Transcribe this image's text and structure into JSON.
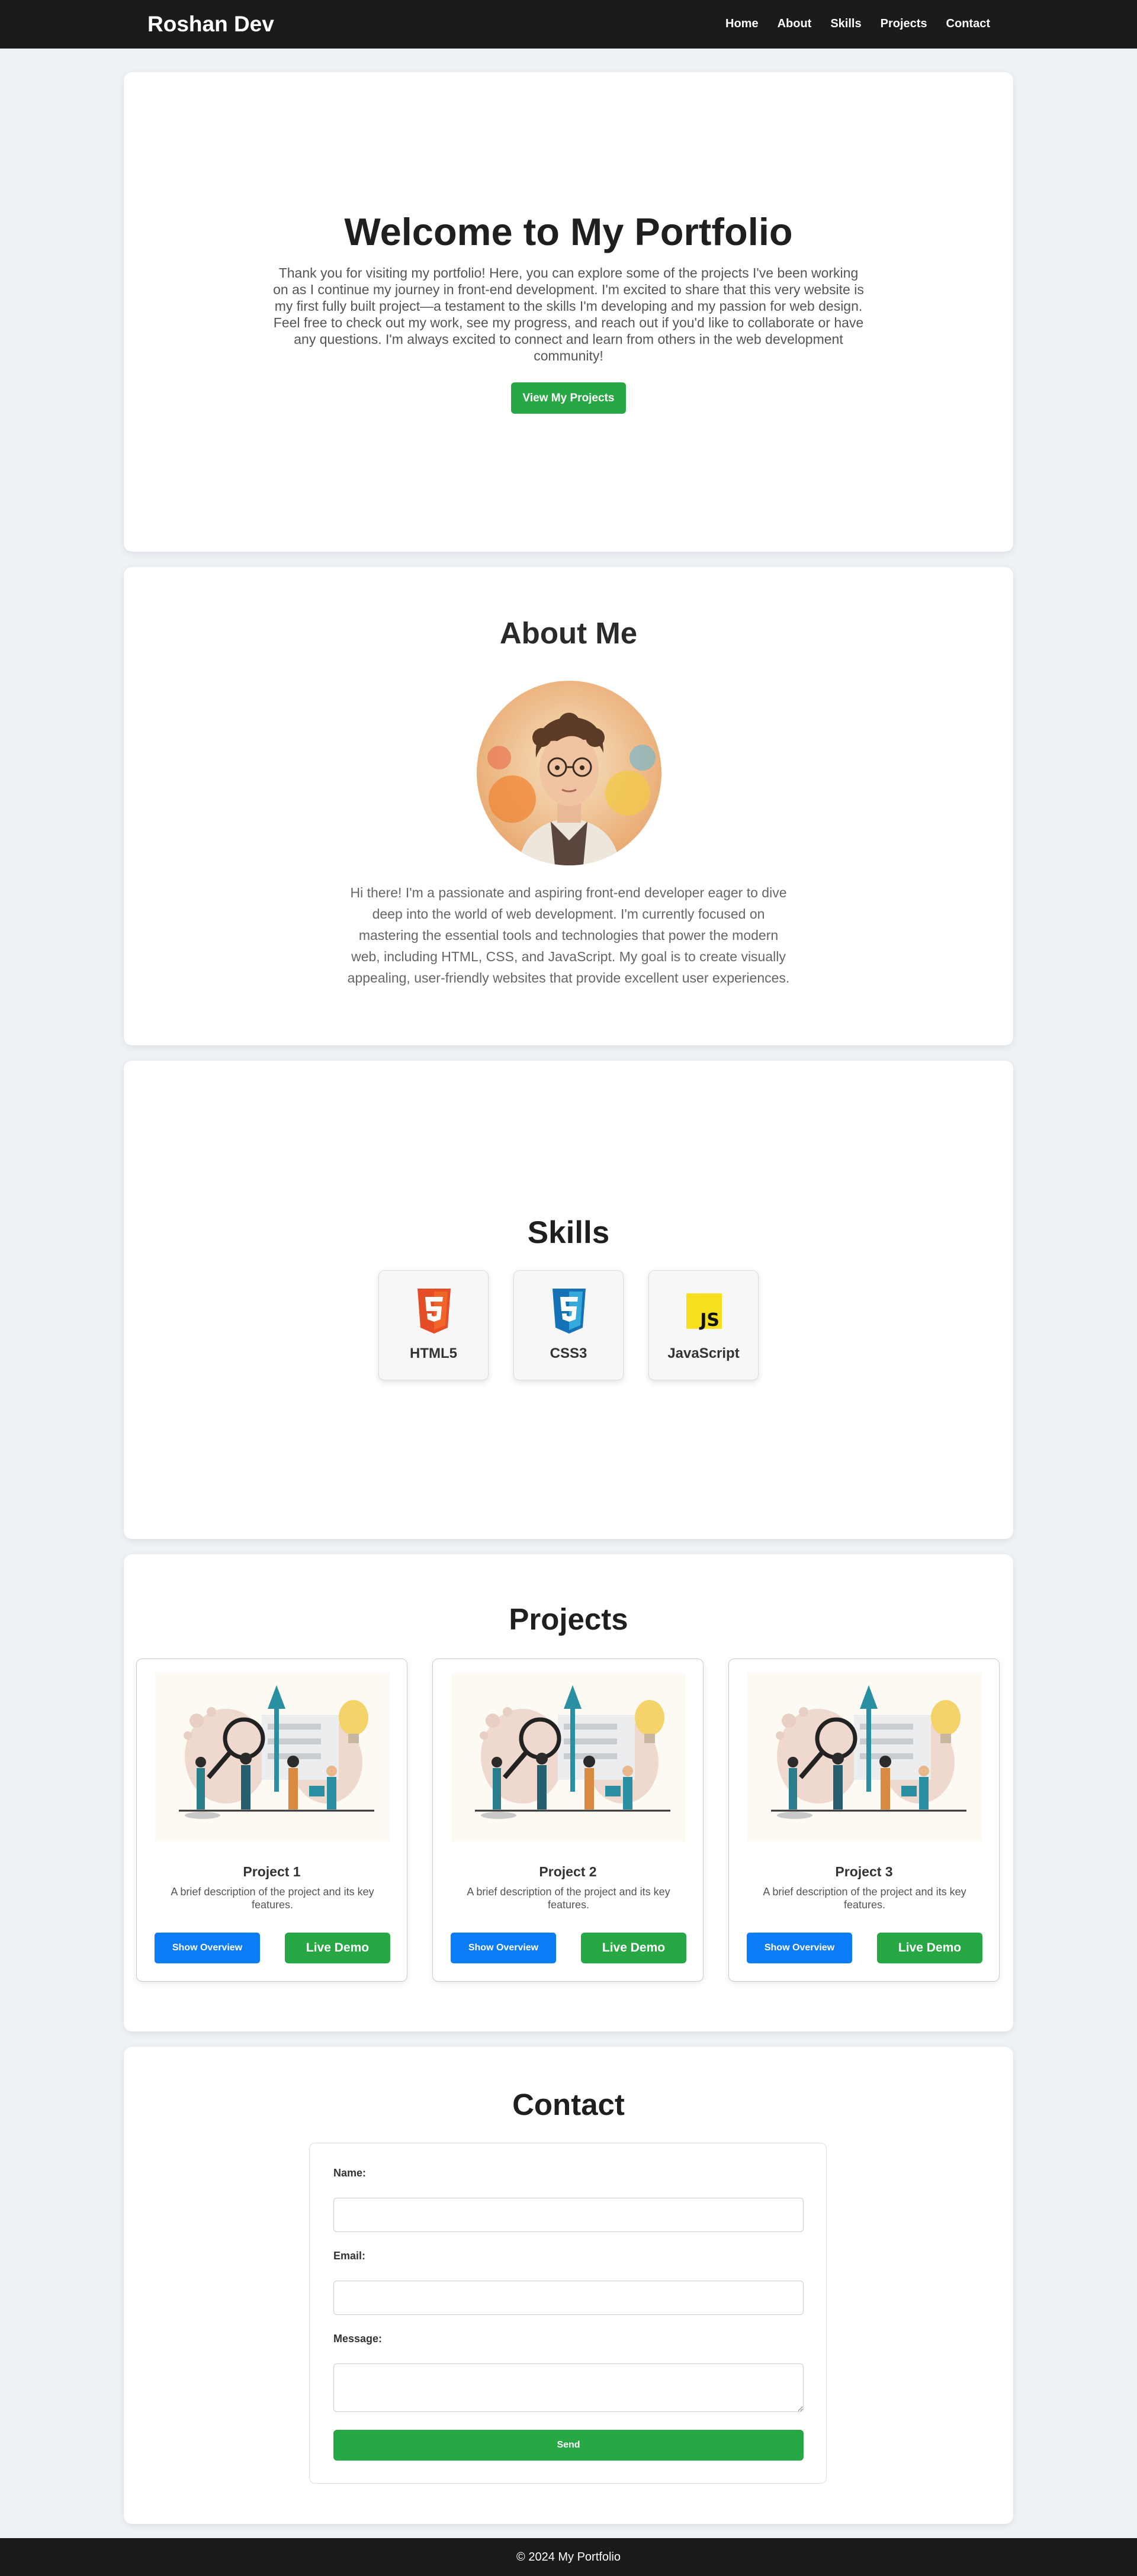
{
  "nav": {
    "brand": "Roshan Dev",
    "links": [
      "Home",
      "About",
      "Skills",
      "Projects",
      "Contact"
    ]
  },
  "hero": {
    "title": "Welcome to My Portfolio",
    "text": "Thank you for visiting my portfolio! Here, you can explore some of the projects I've been working on as I continue my journey in front-end development. I'm excited to share that this very website is my first fully built project—a testament to the skills I'm developing and my passion for web design. Feel free to check out my work, see my progress, and reach out if you'd like to collaborate or have any questions. I'm always excited to connect and learn from others in the web development community!",
    "button": "View My Projects"
  },
  "about": {
    "title": "About Me",
    "text": "Hi there! I'm a passionate and aspiring front-end developer eager to dive deep into the world of web development. I'm currently focused on mastering the essential tools and technologies that power the modern web, including HTML, CSS, and JavaScript. My goal is to create visually appealing, user-friendly websites that provide excellent user experiences."
  },
  "skills": {
    "title": "Skills",
    "items": [
      {
        "label": "HTML5",
        "icon": "html5-icon",
        "color": "#e44d26"
      },
      {
        "label": "CSS3",
        "icon": "css3-icon",
        "color": "#1572b6"
      },
      {
        "label": "JavaScript",
        "icon": "javascript-icon",
        "color": "#f7df1e"
      }
    ]
  },
  "projects": {
    "title": "Projects",
    "items": [
      {
        "title": "Project 1",
        "desc": "A brief description of the project and its key features.",
        "overview": "Show Overview",
        "demo": "Live Demo"
      },
      {
        "title": "Project 2",
        "desc": "A brief description of the project and its key features.",
        "overview": "Show Overview",
        "demo": "Live Demo"
      },
      {
        "title": "Project 3",
        "desc": "A brief description of the project and its key features.",
        "overview": "Show Overview",
        "demo": "Live Demo"
      }
    ]
  },
  "contact": {
    "title": "Contact",
    "name_label": "Name:",
    "email_label": "Email:",
    "message_label": "Message:",
    "name_value": "",
    "email_value": "",
    "message_value": "",
    "send": "Send"
  },
  "footer": {
    "text": "© 2024 My Portfolio"
  },
  "colors": {
    "accent_green": "#28a745",
    "accent_blue": "#0b7cf7",
    "dark": "#1b1b1b",
    "background": "#eef2f7"
  }
}
